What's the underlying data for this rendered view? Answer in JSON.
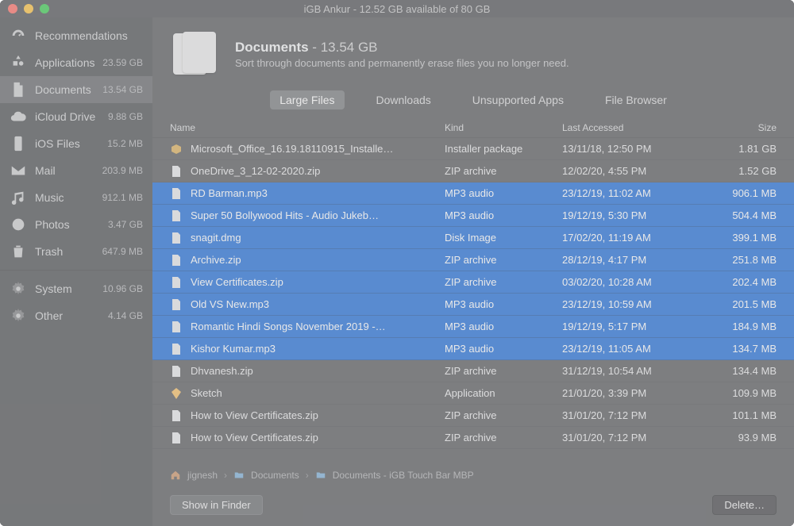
{
  "window": {
    "title": "iGB Ankur - 12.52 GB available of 80 GB"
  },
  "sidebar": {
    "items": [
      {
        "icon": "gauge-icon",
        "label": "Recommendations",
        "size": ""
      },
      {
        "icon": "apps-icon",
        "label": "Applications",
        "size": "23.59 GB"
      },
      {
        "icon": "doc-icon",
        "label": "Documents",
        "size": "13.54 GB",
        "active": true
      },
      {
        "icon": "cloud-icon",
        "label": "iCloud Drive",
        "size": "9.88 GB"
      },
      {
        "icon": "phone-icon",
        "label": "iOS Files",
        "size": "15.2 MB"
      },
      {
        "icon": "mail-icon",
        "label": "Mail",
        "size": "203.9 MB"
      },
      {
        "icon": "music-icon",
        "label": "Music",
        "size": "912.1 MB"
      },
      {
        "icon": "photos-icon",
        "label": "Photos",
        "size": "3.47 GB"
      },
      {
        "icon": "trash-icon",
        "label": "Trash",
        "size": "647.9 MB"
      }
    ],
    "extra": [
      {
        "icon": "gear-icon",
        "label": "System",
        "size": "10.96 GB"
      },
      {
        "icon": "gear-icon",
        "label": "Other",
        "size": "4.14 GB"
      }
    ]
  },
  "hero": {
    "title": "Documents",
    "size": "13.54 GB",
    "subtitle": "Sort through documents and permanently erase files you no longer need."
  },
  "tabs": [
    {
      "label": "Large Files",
      "selected": true
    },
    {
      "label": "Downloads"
    },
    {
      "label": "Unsupported Apps"
    },
    {
      "label": "File Browser"
    }
  ],
  "columns": {
    "name": "Name",
    "kind": "Kind",
    "accessed": "Last Accessed",
    "size": "Size"
  },
  "rows": [
    {
      "sel": false,
      "icon": "pkg",
      "name": "Microsoft_Office_16.19.18110915_Installe…",
      "kind": "Installer package",
      "accessed": "13/11/18, 12:50 PM",
      "size": "1.81 GB"
    },
    {
      "sel": false,
      "icon": "file",
      "name": "OneDrive_3_12-02-2020.zip",
      "kind": "ZIP archive",
      "accessed": "12/02/20, 4:55 PM",
      "size": "1.52 GB"
    },
    {
      "sel": true,
      "icon": "file",
      "name": "RD Barman.mp3",
      "kind": "MP3 audio",
      "accessed": "23/12/19, 11:02 AM",
      "size": "906.1 MB"
    },
    {
      "sel": true,
      "icon": "file",
      "name": "Super 50 Bollywood Hits - Audio Jukeb…",
      "kind": "MP3 audio",
      "accessed": "19/12/19, 5:30 PM",
      "size": "504.4 MB"
    },
    {
      "sel": true,
      "icon": "file",
      "name": "snagit.dmg",
      "kind": "Disk Image",
      "accessed": "17/02/20, 11:19 AM",
      "size": "399.1 MB"
    },
    {
      "sel": true,
      "icon": "file",
      "name": "Archive.zip",
      "kind": "ZIP archive",
      "accessed": "28/12/19, 4:17 PM",
      "size": "251.8 MB"
    },
    {
      "sel": true,
      "icon": "file",
      "name": "View Certificates.zip",
      "kind": "ZIP archive",
      "accessed": "03/02/20, 10:28 AM",
      "size": "202.4 MB"
    },
    {
      "sel": true,
      "icon": "file",
      "name": "Old VS New.mp3",
      "kind": "MP3 audio",
      "accessed": "23/12/19, 10:59 AM",
      "size": "201.5 MB"
    },
    {
      "sel": true,
      "icon": "file",
      "name": "Romantic Hindi Songs November 2019 -…",
      "kind": "MP3 audio",
      "accessed": "19/12/19, 5:17 PM",
      "size": "184.9 MB"
    },
    {
      "sel": true,
      "icon": "file",
      "name": "Kishor Kumar.mp3",
      "kind": "MP3 audio",
      "accessed": "23/12/19, 11:05 AM",
      "size": "134.7 MB"
    },
    {
      "sel": false,
      "icon": "file",
      "name": "Dhvanesh.zip",
      "kind": "ZIP archive",
      "accessed": "31/12/19, 10:54 AM",
      "size": "134.4 MB"
    },
    {
      "sel": false,
      "icon": "sketch",
      "name": "Sketch",
      "kind": "Application",
      "accessed": "21/01/20, 3:39 PM",
      "size": "109.9 MB"
    },
    {
      "sel": false,
      "icon": "file",
      "name": "How to View Certificates.zip",
      "kind": "ZIP archive",
      "accessed": "31/01/20, 7:12 PM",
      "size": "101.1 MB"
    },
    {
      "sel": false,
      "icon": "file",
      "name": "How to View Certificates.zip",
      "kind": "ZIP archive",
      "accessed": "31/01/20, 7:12 PM",
      "size": "93.9 MB"
    }
  ],
  "breadcrumbs": [
    {
      "icon": "home-icon",
      "label": "jignesh"
    },
    {
      "icon": "folder-icon",
      "label": "Documents"
    },
    {
      "icon": "folder-icon",
      "label": "Documents - iGB Touch Bar MBP"
    }
  ],
  "footer": {
    "show": "Show in Finder",
    "delete": "Delete…"
  }
}
